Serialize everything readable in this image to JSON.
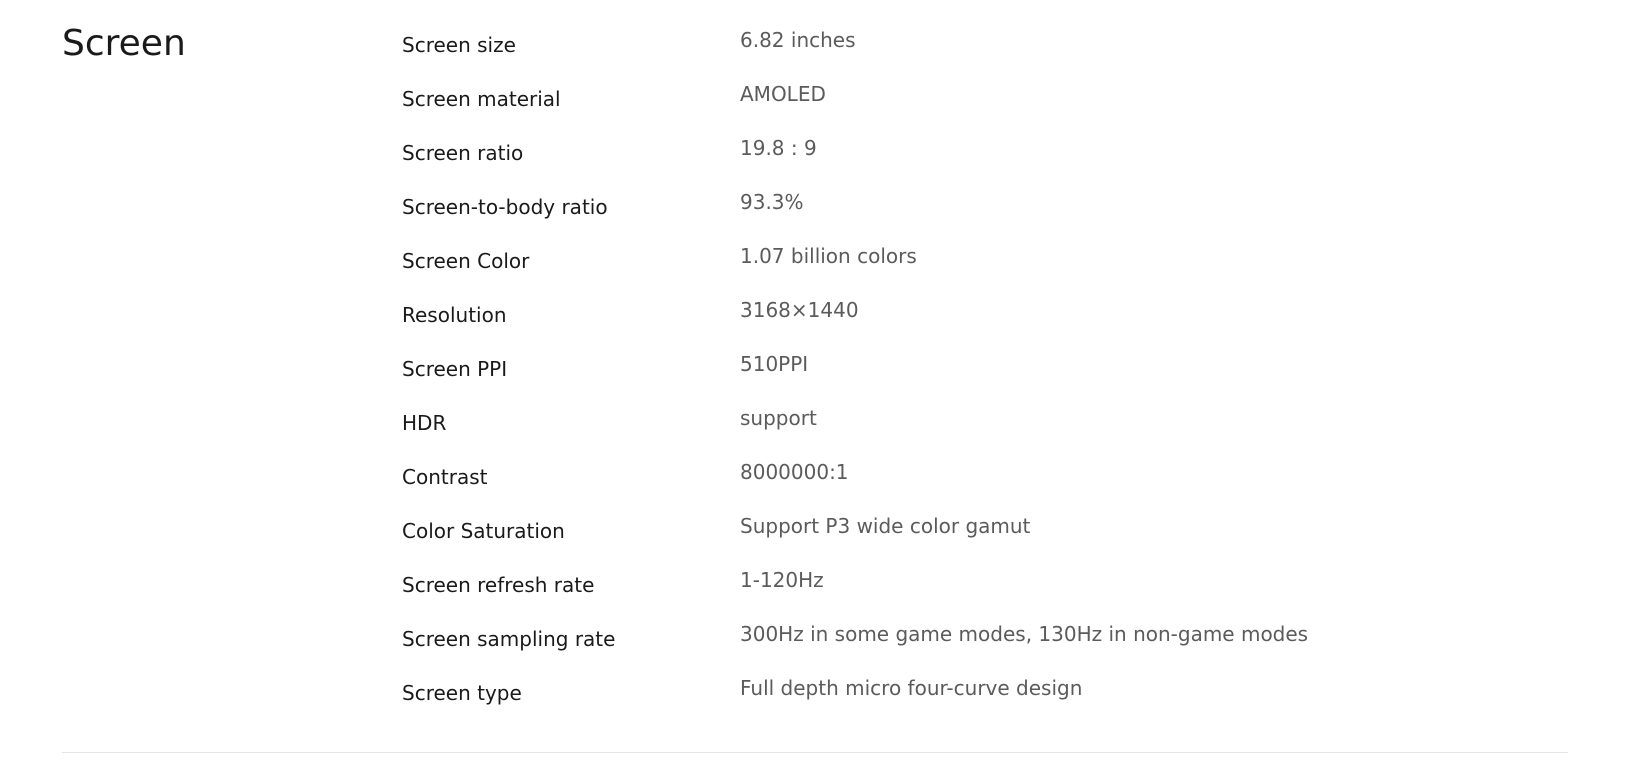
{
  "section": {
    "title": "Screen",
    "specs": [
      {
        "label": "Screen size",
        "value": "6.82 inches"
      },
      {
        "label": "Screen material",
        "value": "AMOLED"
      },
      {
        "label": "Screen ratio",
        "value": "19.8 : 9"
      },
      {
        "label": "Screen-to-body ratio",
        "value": "93.3%"
      },
      {
        "label": "Screen Color",
        "value": "1.07 billion colors"
      },
      {
        "label": "Resolution",
        "value": "3168×1440"
      },
      {
        "label": "Screen PPI",
        "value": "510PPI"
      },
      {
        "label": "HDR",
        "value": "support"
      },
      {
        "label": "Contrast",
        "value": "8000000:1"
      },
      {
        "label": "Color Saturation",
        "value": "Support P3 wide color gamut"
      },
      {
        "label": "Screen refresh rate",
        "value": "1-120Hz"
      },
      {
        "label": "Screen sampling rate",
        "value": "300Hz in some game modes, 130Hz in non-game modes"
      },
      {
        "label": "Screen type",
        "value": "Full depth micro four-curve design"
      }
    ]
  }
}
